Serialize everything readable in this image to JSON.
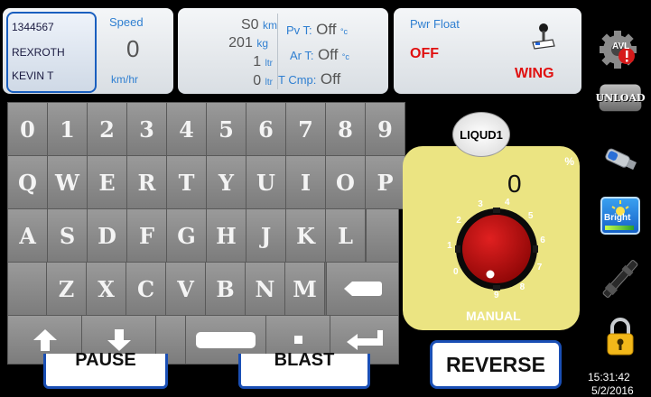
{
  "driver": {
    "line1": "1344567",
    "line2": "REXROTH",
    "line3": "KEVIN T"
  },
  "speed": {
    "label": "Speed",
    "value": "0",
    "unit": "km/hr"
  },
  "stats": [
    {
      "value": "S0",
      "unit": "km"
    },
    {
      "value": "201",
      "unit": "kg"
    },
    {
      "value": "1",
      "unit": "ltr"
    },
    {
      "value": "0",
      "unit": "ltr"
    }
  ],
  "temps": [
    {
      "label": "Pv T:",
      "value": "Off",
      "unit": "°c"
    },
    {
      "label": "Ar T:",
      "value": "Off",
      "unit": "°c"
    },
    {
      "label": "T Cmp:",
      "value": "Off",
      "unit": ""
    }
  ],
  "pwr": {
    "label": "Pwr Float",
    "state": "OFF",
    "wing": "WING"
  },
  "keyboard": {
    "row1": [
      "0",
      "1",
      "2",
      "3",
      "4",
      "5",
      "6",
      "7",
      "8",
      "9"
    ],
    "row2": [
      "Q",
      "W",
      "E",
      "R",
      "T",
      "Y",
      "U",
      "I",
      "O",
      "P"
    ],
    "row3": [
      "A",
      "S",
      "D",
      "F",
      "G",
      "H",
      "J",
      "K",
      "L"
    ],
    "row4": [
      "Z",
      "X",
      "C",
      "V",
      "B",
      "N",
      "M"
    ]
  },
  "dial": {
    "button": "LIQUD1",
    "percent_symbol": "%",
    "value": "0",
    "ticks": [
      "0",
      "1",
      "2",
      "3",
      "4",
      "5",
      "6",
      "7",
      "8",
      "9"
    ],
    "mode": "MANUAL"
  },
  "buttons": {
    "pause": "PAUSE",
    "blast": "BLAST",
    "reverse": "REVERSE"
  },
  "side": {
    "avl": "AVL",
    "unload": "UNLOAD",
    "bright": "Bright"
  },
  "clock": {
    "time": "15:31:42",
    "date": "5/2/2016"
  },
  "colors": {
    "accent_blue": "#1a4fb5",
    "label_blue": "#2f7fd1",
    "alert_red": "#e01010",
    "dial_yellow": "#ebe482",
    "knob_red": "#c41010"
  }
}
